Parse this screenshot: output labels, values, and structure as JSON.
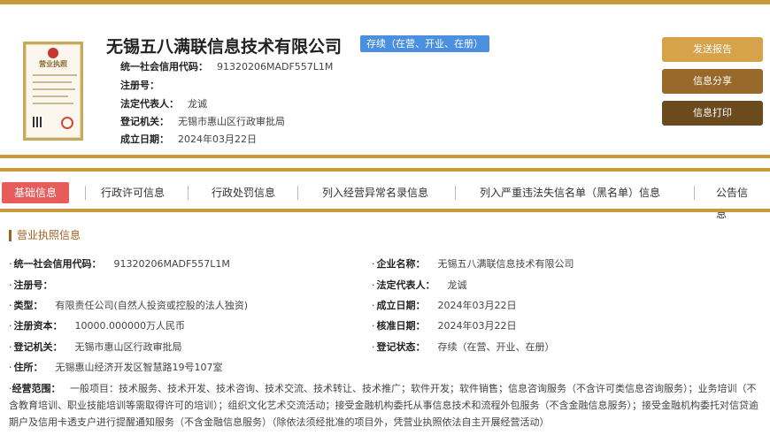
{
  "header": {
    "company_name": "无锡五八满联信息技术有限公司",
    "status_badge": "存续（在营、开业、在册）",
    "license_image_title": "营业执照",
    "info": [
      {
        "label": "统一社会信用代码：",
        "value": "91320206MADF557L1M"
      },
      {
        "label": "注册号：",
        "value": ""
      },
      {
        "label": "法定代表人：",
        "value": "龙诚"
      },
      {
        "label": "登记机关：",
        "value": "无锡市惠山区行政审批局"
      },
      {
        "label": "成立日期：",
        "value": "2024年03月22日"
      }
    ],
    "buttons": {
      "send_report": "发送报告",
      "share_info": "信息分享",
      "print_info": "信息打印"
    }
  },
  "tabs": [
    "基础信息",
    "行政许可信息",
    "行政处罚信息",
    "列入经营异常名录信息",
    "列入严重违法失信名单（黑名单）信息",
    "公告信息"
  ],
  "section_title": "营业执照信息",
  "fields": {
    "credit_code": {
      "label": "统一社会信用代码：",
      "value": "91320206MADF557L1M"
    },
    "company_name": {
      "label": "企业名称：",
      "value": "无锡五八满联信息技术有限公司"
    },
    "reg_no": {
      "label": "注册号：",
      "value": ""
    },
    "legal_rep": {
      "label": "法定代表人：",
      "value": "龙诚"
    },
    "type": {
      "label": "类型：",
      "value": "有限责任公司(自然人投资或控股的法人独资)"
    },
    "founded": {
      "label": "成立日期：",
      "value": "2024年03月22日"
    },
    "capital": {
      "label": "注册资本：",
      "value": "10000.000000万人民币"
    },
    "approved": {
      "label": "核准日期：",
      "value": "2024年03月22日"
    },
    "authority": {
      "label": "登记机关：",
      "value": "无锡市惠山区行政审批局"
    },
    "reg_status": {
      "label": "登记状态：",
      "value": "存续（在营、开业、在册）"
    },
    "address": {
      "label": "住所：",
      "value": "无锡惠山经济开发区智慧路19号107室"
    }
  },
  "scope": {
    "label": "经营范围：",
    "value": "一般项目：技术服务、技术开发、技术咨询、技术交流、技术转让、技术推广；软件开发；软件销售；信息咨询服务（不含许可类信息咨询服务）；业务培训（不含教育培训、职业技能培训等需取得许可的培训）；组织文化艺术交流活动；接受金融机构委托从事信息技术和流程外包服务（不含金融信息服务）；接受金融机构委托对信贷逾期户及信用卡透支户进行提醒通知服务（不含金融信息服务）（除依法须经批准的项目外，凭营业执照依法自主开展经营活动）"
  },
  "colors": {
    "gold": "#c79a3c",
    "active_tab": "#e85c5c",
    "status_badge": "#4a8fe0",
    "section_accent": "#a0611e"
  }
}
